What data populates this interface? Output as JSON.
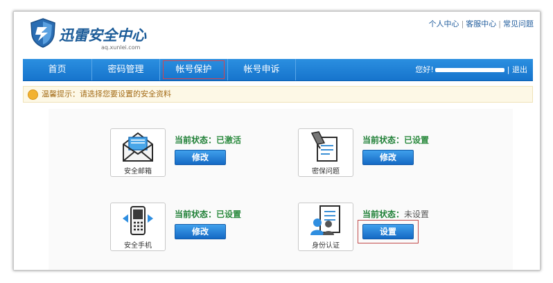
{
  "logo": {
    "title": "迅雷安全中心",
    "subtitle": "aq.xunlei.com"
  },
  "toplinks": {
    "personal": "个人中心",
    "service": "客服中心",
    "faq": "常见问题"
  },
  "nav": {
    "items": [
      {
        "label": "首页"
      },
      {
        "label": "密码管理"
      },
      {
        "label": "帐号保护"
      },
      {
        "label": "帐号申诉"
      }
    ],
    "greeting": "您好!",
    "logout": "退出"
  },
  "tip": {
    "text": "温馨提示：请选择您要设置的安全资料"
  },
  "cards": [
    {
      "label": "安全邮箱",
      "status_prefix": "当前状态：",
      "status_value": "已激活",
      "button": "修改",
      "icon": "mail-icon"
    },
    {
      "label": "密保问题",
      "status_prefix": "当前状态：",
      "status_value": "已设置",
      "button": "修改",
      "icon": "question-icon"
    },
    {
      "label": "安全手机",
      "status_prefix": "当前状态：",
      "status_value": "已设置",
      "button": "修改",
      "icon": "phone-icon"
    },
    {
      "label": "身份认证",
      "status_prefix": "当前状态：",
      "status_value": "未设置",
      "button": "设置",
      "icon": "id-card-icon"
    }
  ],
  "colors": {
    "nav": "#1a7bd6",
    "status_green": "#2b8a3e",
    "tip_text": "#a36b16",
    "highlight": "#d9434b"
  }
}
